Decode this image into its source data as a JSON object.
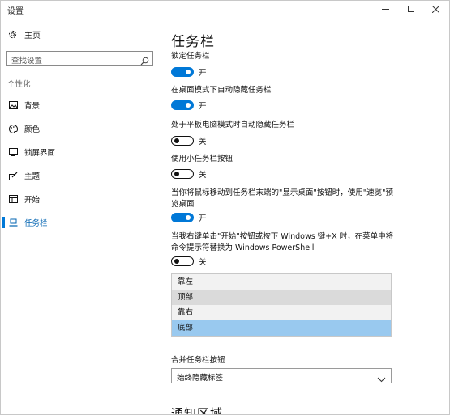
{
  "window": {
    "title": "设置"
  },
  "sidebar": {
    "home_label": "主页",
    "search_placeholder": "查找设置",
    "section_label": "个性化",
    "items": [
      {
        "label": "背景",
        "icon": "image-icon"
      },
      {
        "label": "颜色",
        "icon": "palette-icon"
      },
      {
        "label": "锁屏界面",
        "icon": "lock-screen-icon"
      },
      {
        "label": "主题",
        "icon": "theme-icon"
      },
      {
        "label": "开始",
        "icon": "start-icon"
      },
      {
        "label": "任务栏",
        "icon": "taskbar-icon",
        "selected": true
      }
    ]
  },
  "main": {
    "title": "任务栏",
    "settings": [
      {
        "label": "锁定任务栏",
        "state": "开",
        "on": true
      },
      {
        "label": "在桌面模式下自动隐藏任务栏",
        "state": "开",
        "on": true
      },
      {
        "label": "处于平板电脑模式时自动隐藏任务栏",
        "state": "关",
        "on": false
      },
      {
        "label": "使用小任务栏按钮",
        "state": "关",
        "on": false
      },
      {
        "label": "当你将鼠标移动到任务栏末端的\"显示桌面\"按钮时，使用\"速览\"预览桌面",
        "state": "开",
        "on": true
      },
      {
        "label": "当我右键单击\"开始\"按钮或按下 Windows 键+X 时，在菜单中将命令提示符替换为 Windows PowerShell",
        "state": "关",
        "on": false
      }
    ],
    "position_options": [
      {
        "label": "靠左"
      },
      {
        "label": "顶部",
        "hover": true
      },
      {
        "label": "靠右"
      },
      {
        "label": "底部",
        "selected": true
      }
    ],
    "combine_label": "合并任务栏按钮",
    "combine_value": "始终隐藏标签",
    "notification_heading": "通知区域"
  },
  "colors": {
    "accent": "#0078d7",
    "selected_option": "#99c9ef",
    "hover_option": "#dadada"
  }
}
